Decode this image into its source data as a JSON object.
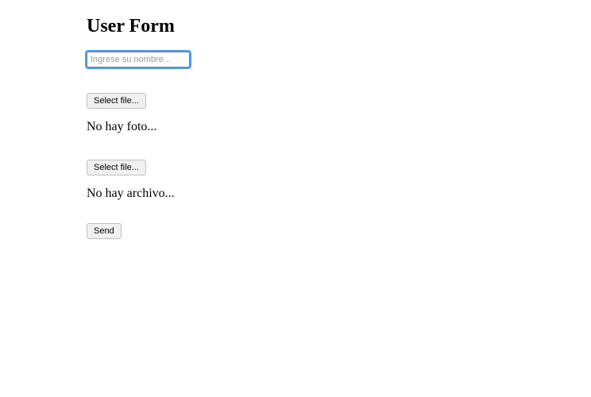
{
  "header": {
    "title": "User Form"
  },
  "name": {
    "placeholder": "Ingrese su nombre...",
    "value": ""
  },
  "photo": {
    "button_label": "Select file...",
    "status": "No hay foto..."
  },
  "file": {
    "button_label": "Select file...",
    "status": "No hay archivo..."
  },
  "submit": {
    "label": "Send"
  }
}
